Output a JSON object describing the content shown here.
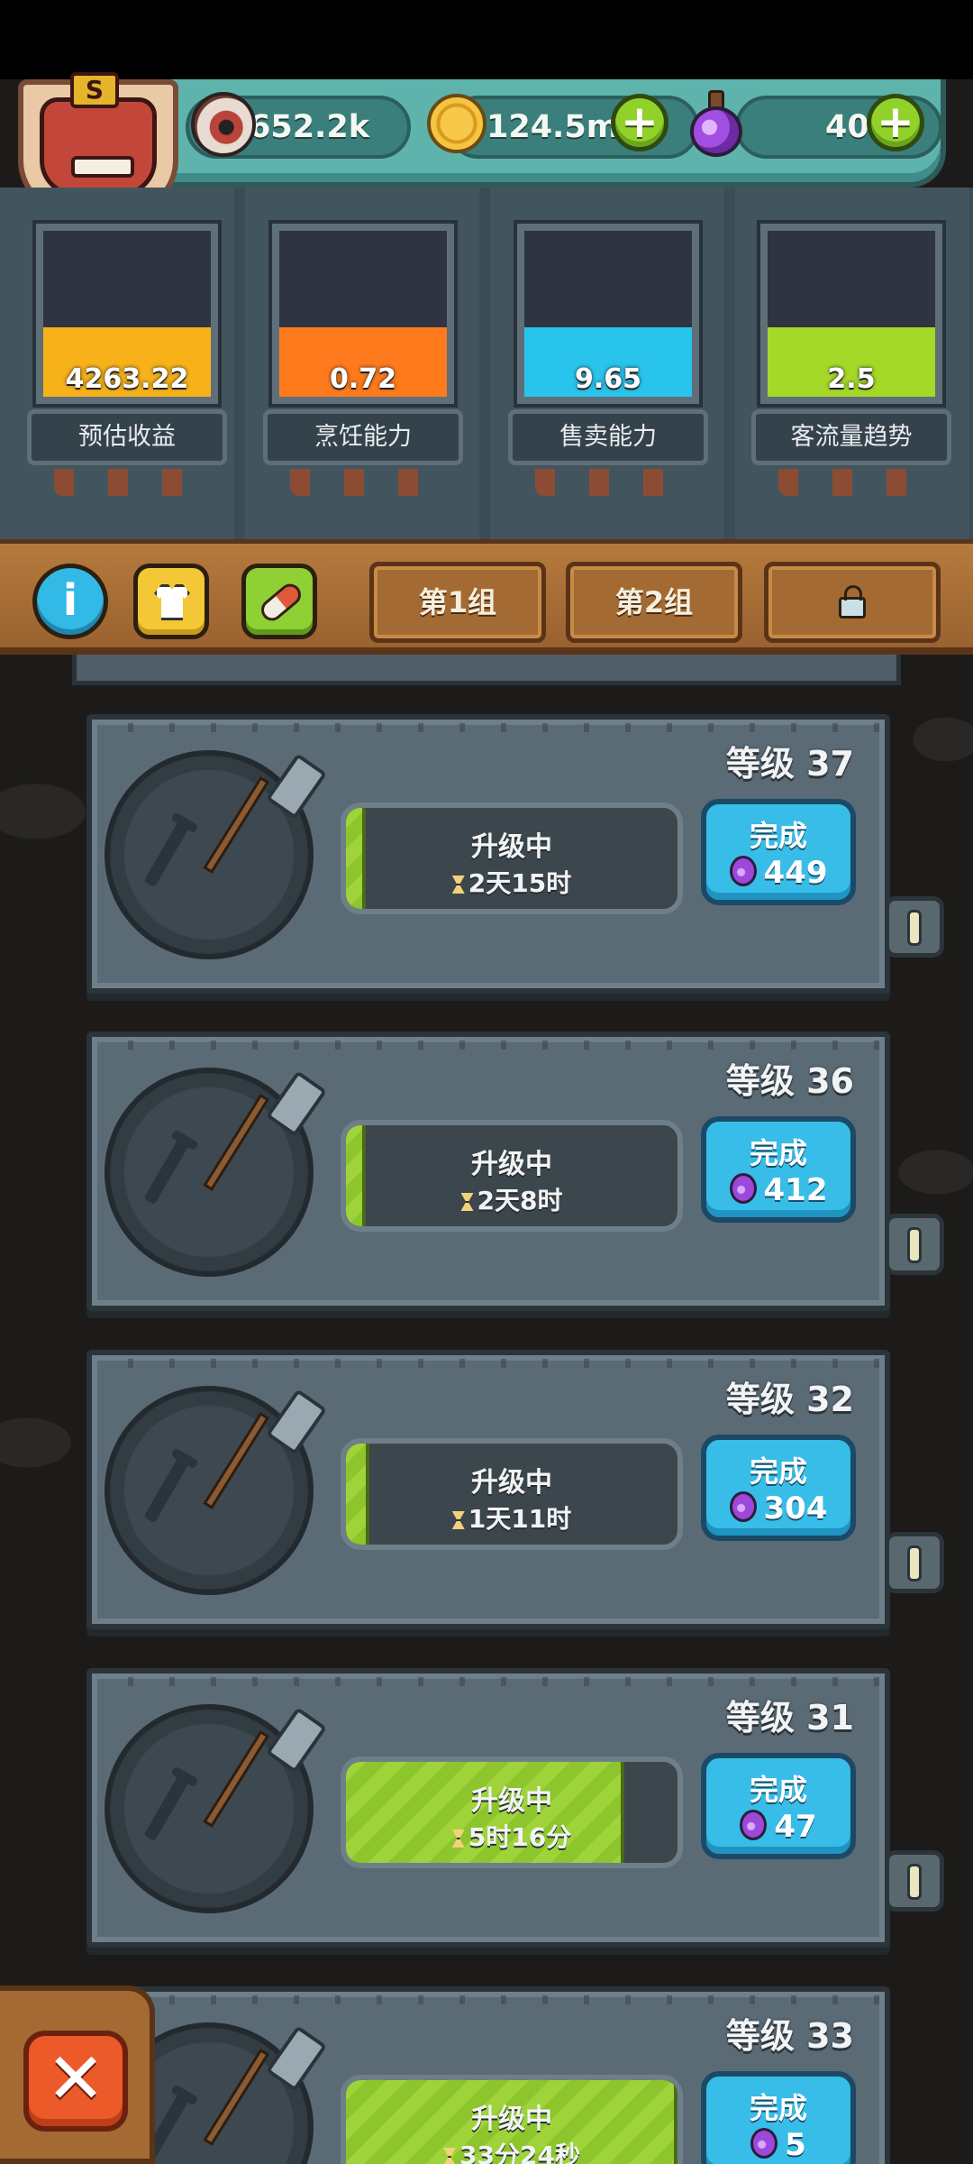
{
  "resources": {
    "eyes": "652.2k",
    "coins": "124.5m",
    "potions": "40",
    "plus_label": "+"
  },
  "avatar": {
    "badge": "S"
  },
  "meters": [
    {
      "value": "4263.22",
      "label": "预估收益",
      "level": 0.42,
      "color": "#f7b21a"
    },
    {
      "value": "0.72",
      "label": "烹饪能力",
      "level": 0.42,
      "color": "#ff7a1c"
    },
    {
      "value": "9.65",
      "label": "售卖能力",
      "level": 0.42,
      "color": "#29c4ec"
    },
    {
      "value": "2.5",
      "label": "客流量趋势",
      "level": 0.42,
      "color": "#a5d927"
    }
  ],
  "toolbar": {
    "info_label": "i",
    "tabs": [
      "第1组",
      "第2组"
    ]
  },
  "cards": [
    {
      "level": "等级 37",
      "status": "升级中",
      "time": "2天15时",
      "done": "完成",
      "cost": "449",
      "progress": 0.06
    },
    {
      "level": "等级 36",
      "status": "升级中",
      "time": "2天8时",
      "done": "完成",
      "cost": "412",
      "progress": 0.06
    },
    {
      "level": "等级 32",
      "status": "升级中",
      "time": "1天11时",
      "done": "完成",
      "cost": "304",
      "progress": 0.07
    },
    {
      "level": "等级 31",
      "status": "升级中",
      "time": "5时16分",
      "done": "完成",
      "cost": "47",
      "progress": 0.84
    },
    {
      "level": "等级 33",
      "status": "升级中",
      "time": "33分24秒",
      "done": "完成",
      "cost": "5",
      "progress": 1.0
    }
  ],
  "close_label": "✕"
}
